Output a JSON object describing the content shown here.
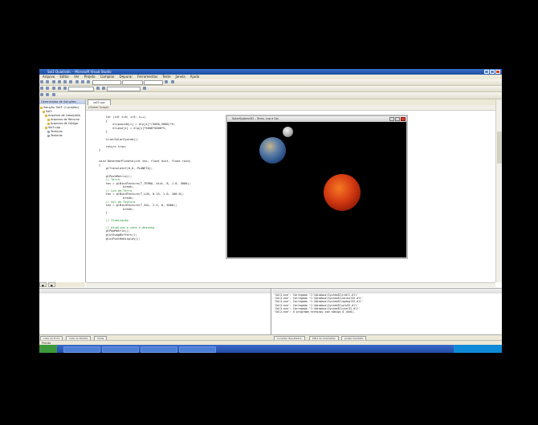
{
  "window_title": "Sol3 Quadratic – Microsoft Visual Studio",
  "menu": [
    "Arquivo",
    "Editar",
    "Ver",
    "Projeto",
    "Compilar",
    "Depurar",
    "Ferramentas",
    "Teste",
    "Janela",
    "Ajuda"
  ],
  "solution_explorer": {
    "title": "Gerenciador de Soluções",
    "items": [
      "Solução 'Sol3' (1 projeto)",
      "Sol3",
      "Arquivos de Cabeçalho",
      "Arquivos de Recurso",
      "Arquivos de Código",
      "Sol3.cpp",
      "Texturas",
      "Texturas"
    ]
  },
  "editor": {
    "tab": "sol3.cpp",
    "nav": "(Global Scope)",
    "code": [
      "    for (int i=0; i<3; i++)",
      "    {",
      "        elipsoide[i] = elp[i]*(5000,5000)*5;",
      "        elipse[i] = elp[i]*5000*5000*5;",
      "    }",
      "",
      "    CriarSolarSystem();",
      "",
      "    return true;",
      "}",
      "",
      "",
      "void DesenharPlaneta(int tex, float dist, float raio)",
      "{",
      "    glTranslatef(0,0,-PLANETA);",
      "",
      "    glPushMatrix();",
      "    // Terra",
      "    tex = glBindTexture(T_TERRA, dist, 8, 1.0, 5000);",
      "              break;",
      "    // Lua da Terra",
      "    tex = glBindTexture(T_LUA, 0.15, 1.0, 100.0);",
      "              break;",
      "    // Sol de Textura",
      "    tex = glBindTexture(T_SOL, 2.5, 0, 5000);",
      "              break;",
      "    }",
      "",
      "    // Iluminação",
      "",
      "    // Atualiza a cena e desenha",
      "    glPopMatrix();",
      "    glutSwapBuffers();",
      "    glutPostRedisplay();"
    ]
  },
  "output_panel": {
    "lines": [
      "'Sol3.exe': Carregado 'C:\\Windows\\System32\\ntdll.dll'",
      "'Sol3.exe': Carregado 'C:\\Windows\\System32\\kernel32.dll'",
      "'Sol3.exe': Carregado 'C:\\Windows\\System32\\opengl32.dll'",
      "'Sol3.exe': Carregado 'C:\\Windows\\System32\\glu32.dll'",
      "'Sol3.exe': Carregado 'C:\\Windows\\System32\\user32.dll'",
      "'Sol3.exe': O programa terminou com código 0 (0x0)."
    ]
  },
  "bottom_tabs": [
    "Lista de Erros",
    "Lista de Tarefas",
    "Saída",
    "Localizar Resultados",
    "Pilha de Chamadas",
    "Janela Imediata"
  ],
  "status": "Pronto",
  "app_window": {
    "title": "SolarSystem3D – Terra, Lua e Sol"
  }
}
